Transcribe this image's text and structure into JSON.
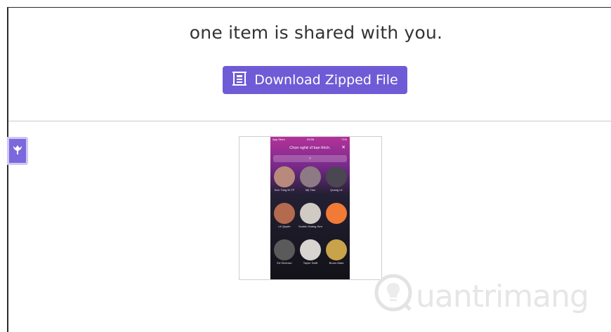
{
  "share": {
    "message": "one item is shared with you.",
    "download_label": "Download Zipped File"
  },
  "sidebar": {
    "tab_icon": "flower-icon"
  },
  "preview": {
    "status_left": "App Store",
    "status_time": "09:58",
    "status_right": "71%",
    "title": "Chọn nghệ sĩ bạn thích.",
    "close": "✕",
    "search_icon": "⌕",
    "artists": [
      {
        "name": "Sơn Tùng M-TP",
        "color": "#b88a7c"
      },
      {
        "name": "Mỹ Tâm",
        "color": "#8d7a85"
      },
      {
        "name": "Quang Lê",
        "color": "#4a4652"
      },
      {
        "name": "Lê Quyên",
        "color": "#b46a4e"
      },
      {
        "name": "Soobin Hoàng Sơn",
        "color": "#cfcac4"
      },
      {
        "name": "",
        "color": "#f07a36"
      },
      {
        "name": "Ed Sheeran",
        "color": "#5a5a5a"
      },
      {
        "name": "Taylor Swift",
        "color": "#d8d4cf"
      },
      {
        "name": "Bruno Mars",
        "color": "#c9a34a"
      }
    ]
  },
  "watermark": {
    "text": "uantrimang",
    "icon": "lightbulb-icon"
  }
}
